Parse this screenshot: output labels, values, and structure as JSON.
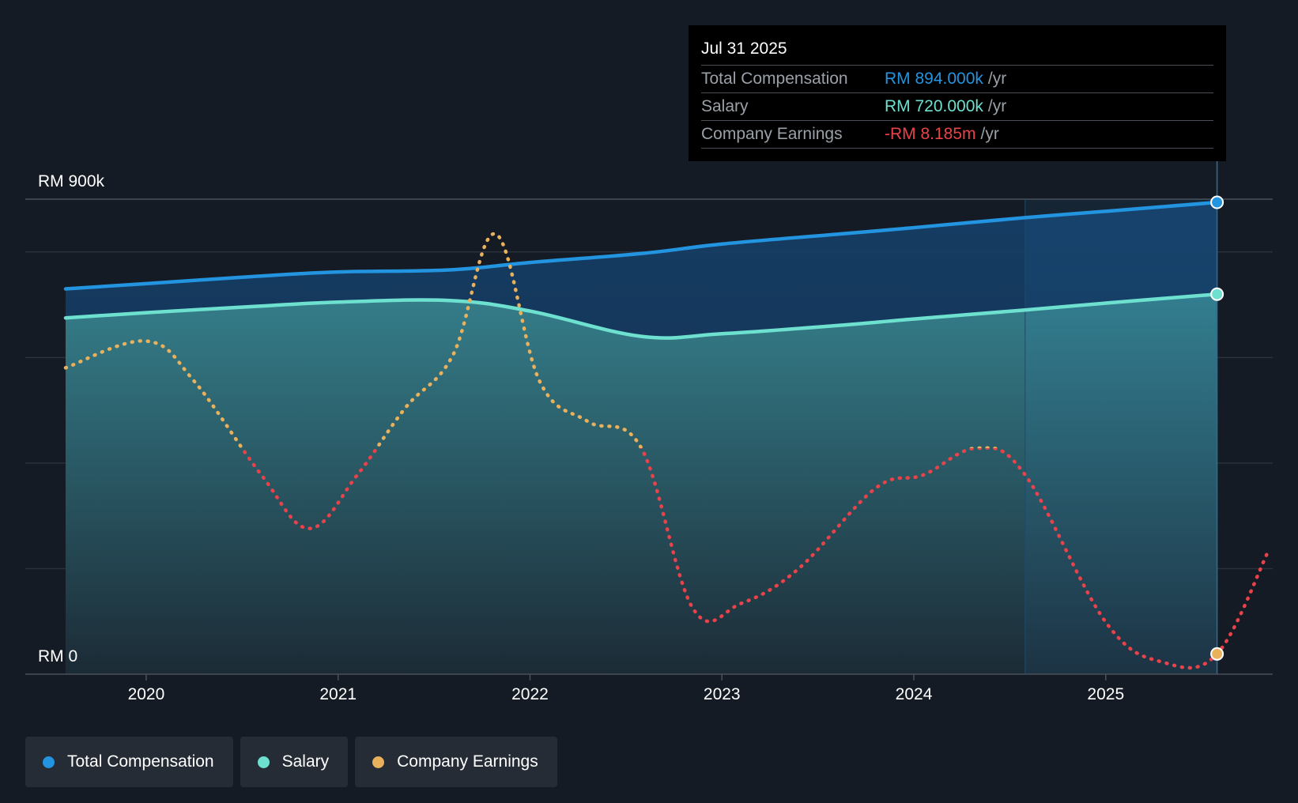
{
  "colors": {
    "background": "#151b24",
    "total_compensation": "#2394df",
    "salary": "#6ee0cf",
    "earnings_positive": "#e9b15c",
    "earnings_negative": "#e8424a",
    "tooltip_bg": "#000000"
  },
  "tooltip": {
    "date": "Jul 31 2025",
    "rows": [
      {
        "label": "Total Compensation",
        "value": "RM 894.000k",
        "unit": "/yr",
        "color": "#2394df"
      },
      {
        "label": "Salary",
        "value": "RM 720.000k",
        "unit": "/yr",
        "color": "#6ee0cf"
      },
      {
        "label": "Company Earnings",
        "value": "-RM 8.185m",
        "unit": "/yr",
        "color": "#e8424a"
      }
    ]
  },
  "legend": [
    {
      "label": "Total Compensation",
      "color": "#2394df"
    },
    {
      "label": "Salary",
      "color": "#6ee0cf"
    },
    {
      "label": "Company Earnings",
      "color": "#e9b15c"
    }
  ],
  "chart_data": {
    "type": "line",
    "title": "",
    "xlabel": "",
    "ylabel": "",
    "xlim": [
      2019.37,
      2025.87
    ],
    "ylim": [
      0,
      900000
    ],
    "ytick_labels": [
      {
        "value": 900000,
        "label": "RM 900k"
      },
      {
        "value": 0,
        "label": "RM 0"
      }
    ],
    "gridlines": [
      900000,
      800000,
      600000,
      400000,
      200000
    ],
    "xticks": [
      2020,
      2021,
      2022,
      2023,
      2024,
      2025
    ],
    "xtick_labels": [
      "2020",
      "2021",
      "2022",
      "2023",
      "2024",
      "2025"
    ],
    "highlight_band_start": 2024.58,
    "series": [
      {
        "name": "Total Compensation",
        "color": "#2394df",
        "x": [
          2019.58,
          2020.0,
          2020.58,
          2021.0,
          2021.58,
          2022.0,
          2022.58,
          2023.0,
          2023.58,
          2024.0,
          2024.58,
          2025.0,
          2025.58
        ],
        "y": [
          730000,
          740000,
          754000,
          762000,
          766000,
          780000,
          797000,
          815000,
          833000,
          846000,
          865000,
          877000,
          894000
        ]
      },
      {
        "name": "Salary",
        "color": "#6ee0cf",
        "x": [
          2019.58,
          2020.0,
          2020.58,
          2021.0,
          2021.58,
          2022.0,
          2022.58,
          2023.0,
          2023.58,
          2024.0,
          2024.58,
          2025.0,
          2025.58
        ],
        "y": [
          675000,
          685000,
          697000,
          705000,
          708000,
          688000,
          640000,
          645000,
          660000,
          673000,
          690000,
          703000,
          720000
        ]
      },
      {
        "name": "Company Earnings",
        "color": "#e9b15c",
        "negative_color": "#e8424a",
        "x": [
          2019.58,
          2020.0,
          2020.25,
          2020.6,
          2020.85,
          2021.1,
          2021.35,
          2021.6,
          2021.82,
          2022.05,
          2022.3,
          2022.58,
          2022.85,
          2023.1,
          2023.4,
          2023.8,
          2024.05,
          2024.33,
          2024.58,
          2025.0,
          2025.3,
          2025.58,
          2025.85
        ],
        "y": [
          2.5,
          3.5,
          2.0,
          -1.5,
          -3.5,
          -1.5,
          1.0,
          3.0,
          7.5,
          2.0,
          0.5,
          -0.5,
          -6.5,
          -6.3,
          -5.0,
          -2.0,
          -1.5,
          -0.5,
          -1.5,
          -7.0,
          -8.5,
          -8.185,
          -4.3
        ],
        "unit": "RM m",
        "zero_line": -0.5
      }
    ]
  }
}
